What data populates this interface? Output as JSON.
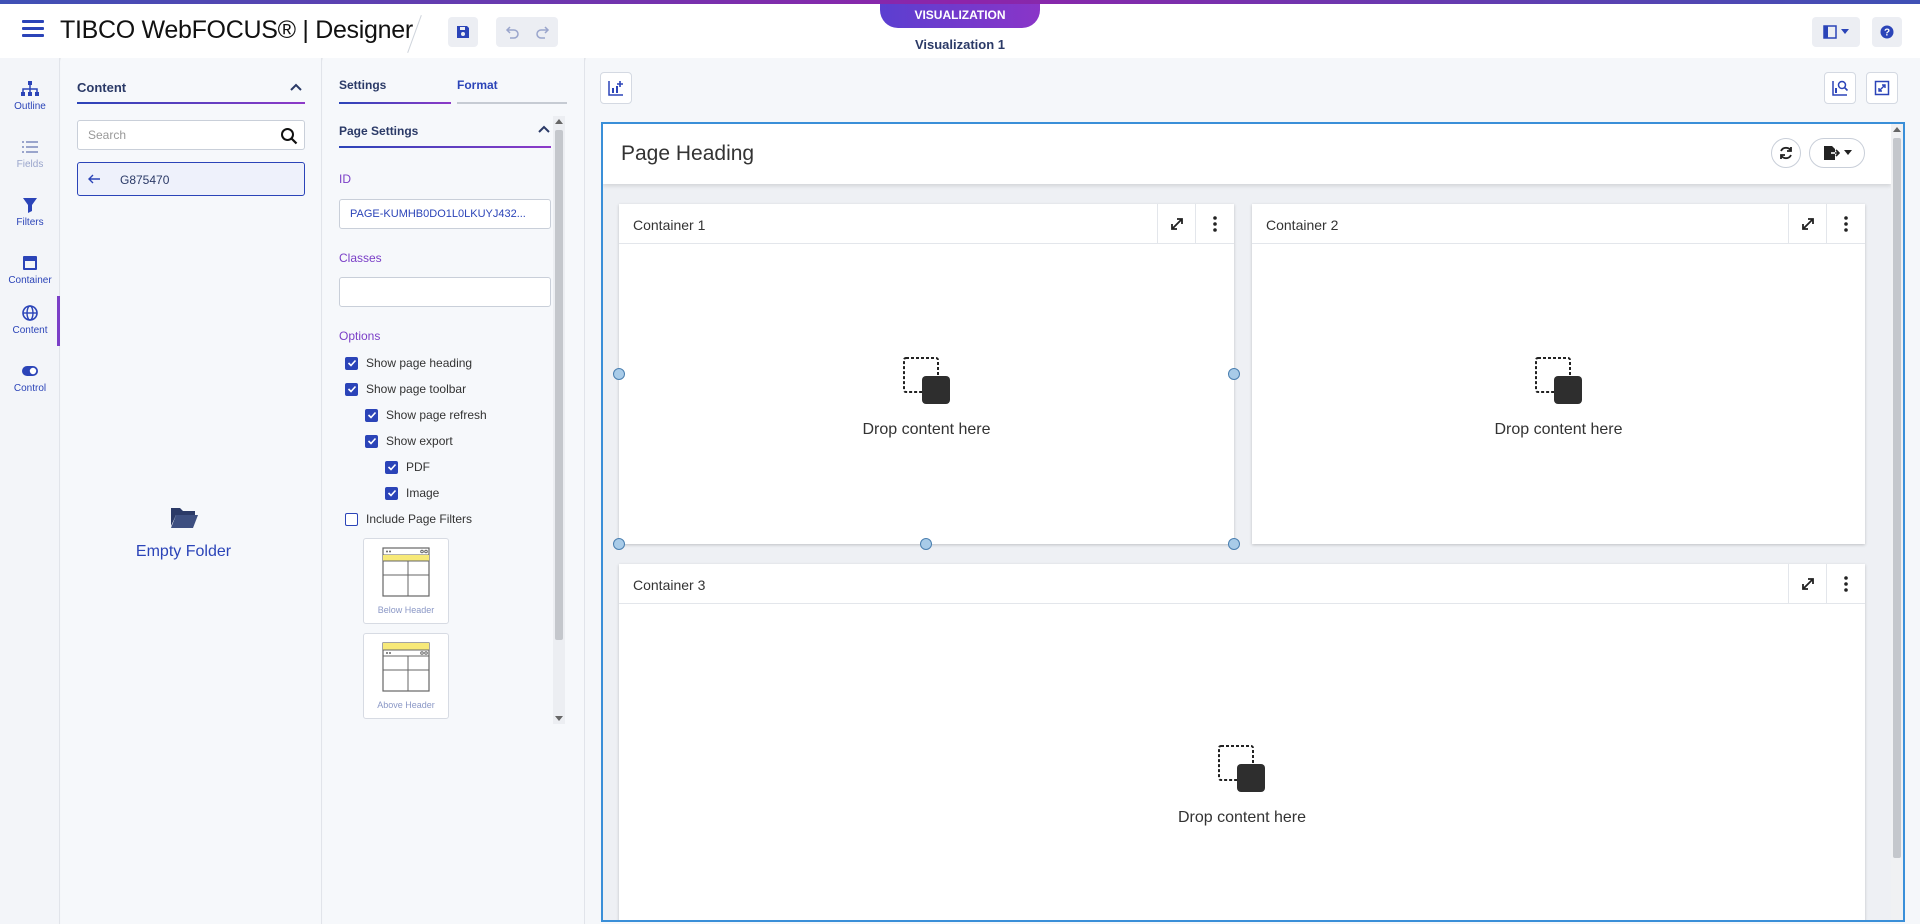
{
  "header": {
    "brand": "TIBCO WebFOCUS® | Designer",
    "mode_pill": "VISUALIZATION",
    "doc_title": "Visualization 1"
  },
  "rail": {
    "items": [
      {
        "label": "Outline",
        "icon": "outline-icon"
      },
      {
        "label": "Fields",
        "icon": "fields-icon"
      },
      {
        "label": "Filters",
        "icon": "filter-icon"
      },
      {
        "label": "Container",
        "icon": "container-icon"
      },
      {
        "label": "Content",
        "icon": "globe-icon"
      },
      {
        "label": "Control",
        "icon": "toggle-icon"
      }
    ]
  },
  "content_panel": {
    "title": "Content",
    "search_placeholder": "Search",
    "folder_name": "G875470",
    "empty_text": "Empty Folder"
  },
  "settings_panel": {
    "tab_settings": "Settings",
    "tab_format": "Format",
    "section_title": "Page Settings",
    "id_label": "ID",
    "id_value": "PAGE-KUMHB0DO1L0LKUYJ432...",
    "classes_label": "Classes",
    "classes_value": "",
    "options_label": "Options",
    "options": {
      "show_heading": "Show page heading",
      "show_toolbar": "Show page toolbar",
      "show_refresh": "Show page refresh",
      "show_export": "Show export",
      "pdf": "PDF",
      "image": "Image",
      "include_filters": "Include Page Filters"
    },
    "layout_below": "Below Header",
    "layout_above": "Above Header"
  },
  "canvas": {
    "page_heading": "Page Heading",
    "containers": [
      {
        "name": "Container 1",
        "drop_text": "Drop content here"
      },
      {
        "name": "Container 2",
        "drop_text": "Drop content here"
      },
      {
        "name": "Container 3",
        "drop_text": "Drop content here"
      }
    ]
  },
  "colors": {
    "accent": "#2b44b8",
    "purple": "#7b3fc7",
    "selection": "#3a8fd8"
  }
}
